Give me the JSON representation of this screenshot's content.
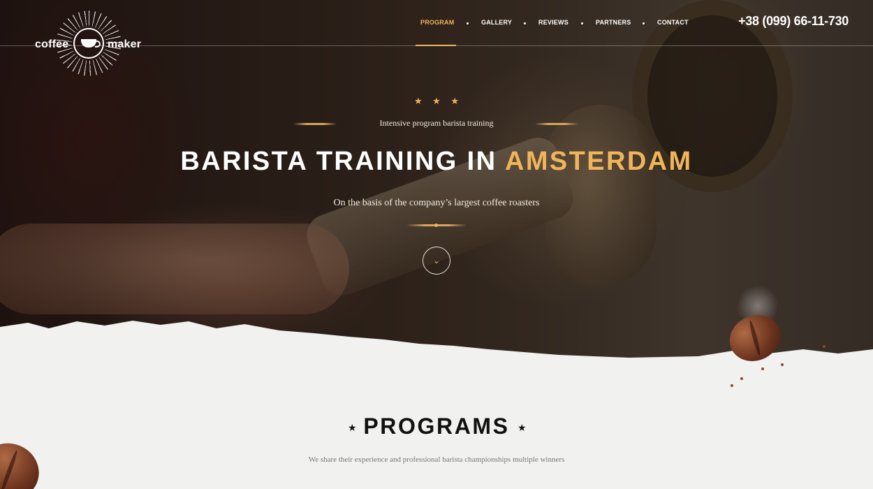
{
  "brand": {
    "word_left": "coffee",
    "word_right": "maker"
  },
  "nav": {
    "items": [
      {
        "label": "PROGRAM",
        "active": true
      },
      {
        "label": "GALLERY",
        "active": false
      },
      {
        "label": "REVIEWS",
        "active": false
      },
      {
        "label": "PARTNERS",
        "active": false
      },
      {
        "label": "CONTACT",
        "active": false
      }
    ],
    "phone": "+38 (099) 66-11-730"
  },
  "hero": {
    "stars": [
      "★",
      "★",
      "★"
    ],
    "tagline": "Intensive program barista training",
    "headline_main": "BARISTA TRAINING IN",
    "headline_accent": "AMSTERDAM",
    "subline": "On the basis of the company’s largest coffee roasters",
    "scroll_icon": "chevron-down-icon",
    "scroll_glyph": "⌄"
  },
  "programs": {
    "title": "PROGRAMS",
    "star_glyph": "★",
    "subtitle": "We share their experience and professional barista championships multiple winners"
  },
  "colors": {
    "accent": "#f0b55a",
    "paper": "#f1f1f0",
    "text_dark": "#111111"
  }
}
